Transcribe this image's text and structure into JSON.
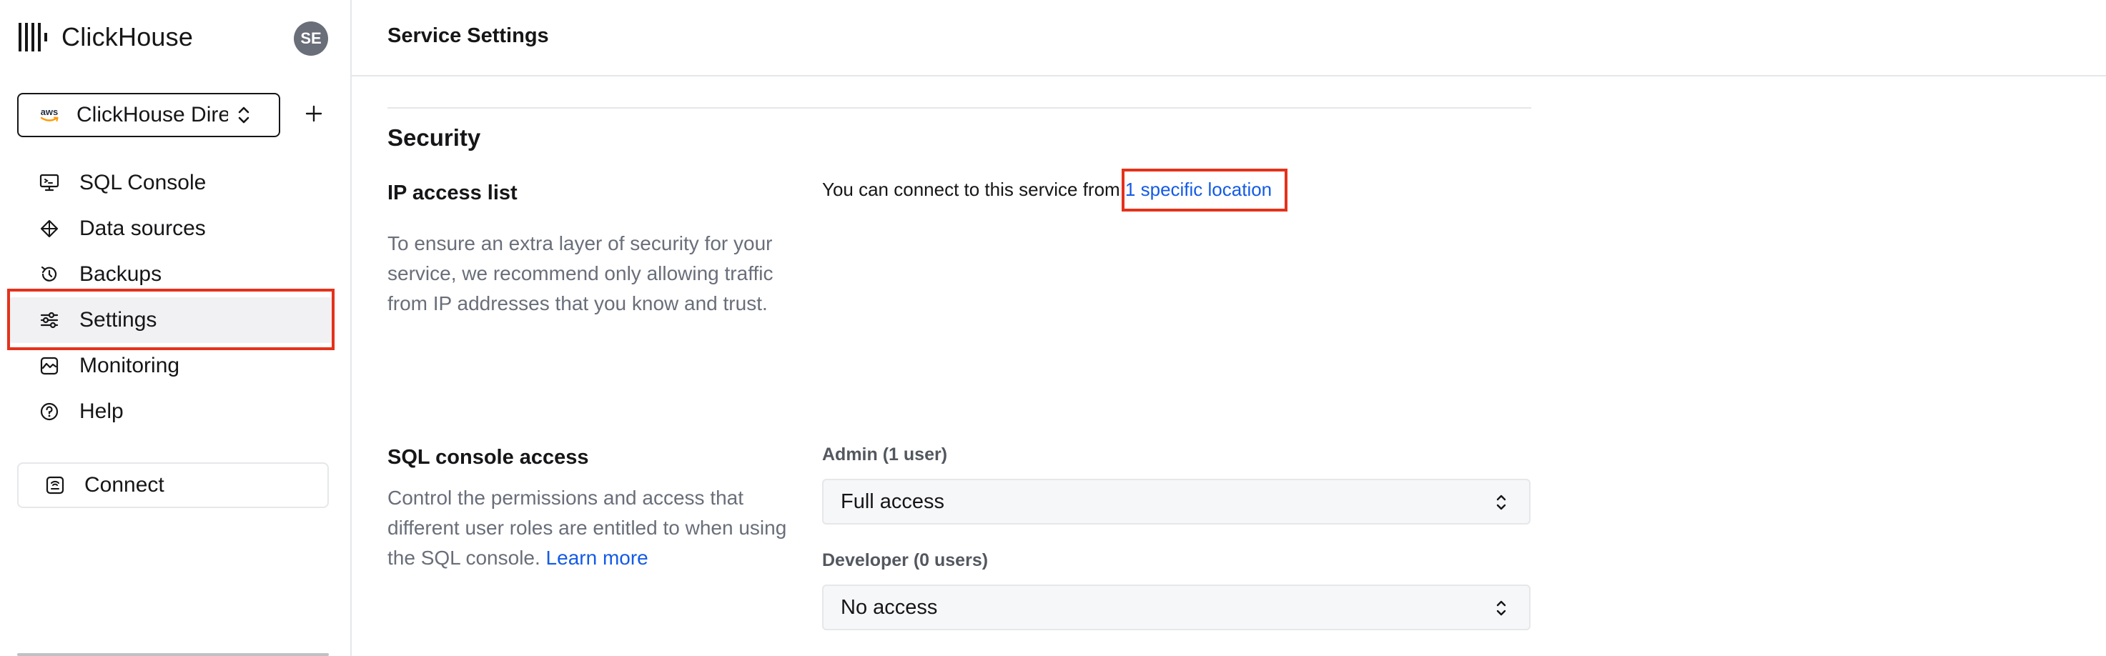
{
  "sidebar": {
    "brand": "ClickHouse",
    "avatar_initials": "SE",
    "service_selector": {
      "provider": "aws",
      "name": "ClickHouse Direct"
    },
    "add_icon": "plus-icon",
    "nav_items": [
      {
        "label": "SQL Console",
        "icon": "sql-console-icon"
      },
      {
        "label": "Data sources",
        "icon": "data-sources-icon"
      },
      {
        "label": "Backups",
        "icon": "backups-icon"
      },
      {
        "label": "Settings",
        "icon": "settings-sliders-icon",
        "active": true
      },
      {
        "label": "Monitoring",
        "icon": "monitoring-icon"
      },
      {
        "label": "Help",
        "icon": "help-icon"
      }
    ],
    "connect_label": "Connect"
  },
  "header": {
    "title": "Service Settings"
  },
  "security": {
    "title": "Security",
    "ip_access": {
      "label": "IP access list",
      "description": "To ensure an extra layer of security for your service, we recommend only allowing traffic from IP addresses that you know and trust.",
      "status_text": "You can connect to this service from ",
      "status_link": "1 specific location"
    },
    "sql_console_access": {
      "label": "SQL console access",
      "description": "Control the permissions and access that different user roles are entitled to when using the SQL console. ",
      "learn_more": "Learn more",
      "roles": [
        {
          "label": "Admin (1 user)",
          "value": "Full access"
        },
        {
          "label": "Developer (0 users)",
          "value": "No access"
        }
      ]
    }
  },
  "colors": {
    "accent_link": "#135be6",
    "highlight": "#e4321b",
    "active_nav_bg": "#f1f1f3",
    "avatar_bg": "#696e79"
  }
}
